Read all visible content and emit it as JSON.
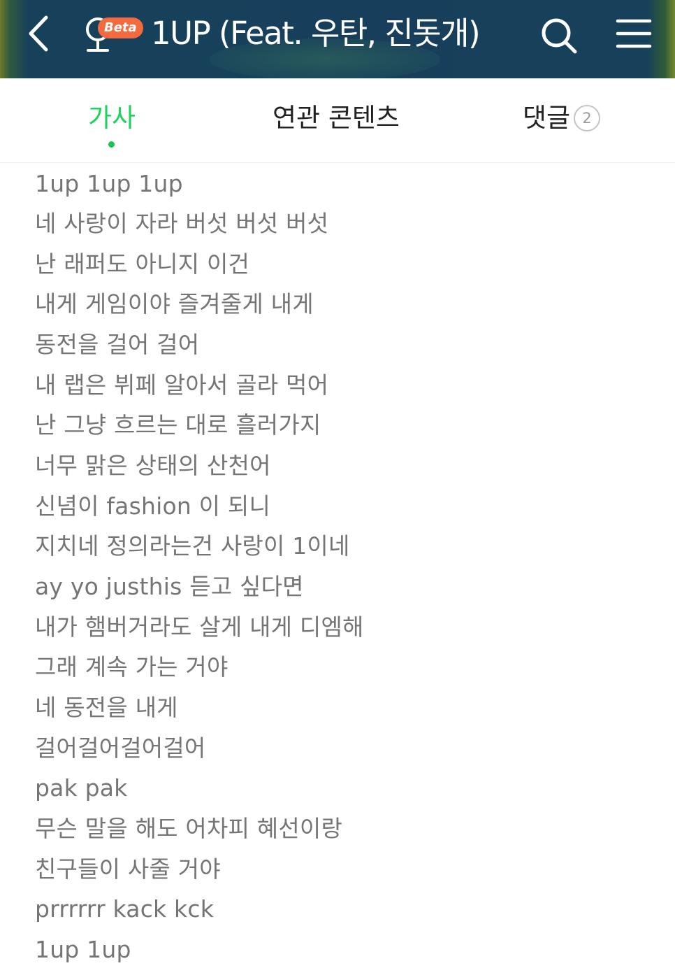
{
  "header": {
    "song_title": "1UP (Feat. 우탄, 진돗개)",
    "beta_badge": "Beta",
    "back_icon": "chevron-left-icon",
    "mic_icon": "microphone-icon",
    "search_icon": "search-icon",
    "menu_icon": "hamburger-menu-icon"
  },
  "tabs": [
    {
      "label": "가사",
      "active": true
    },
    {
      "label": "연관 콘텐츠",
      "active": false
    },
    {
      "label": "댓글",
      "count": "2",
      "active": false
    }
  ],
  "colors": {
    "accent_green": "#1fd25f",
    "header_bg": "#173f5c",
    "beta_badge": "#f26a3d",
    "lyric_text": "#757575"
  },
  "lyrics": [
    "1up 1up 1up",
    "네 사랑이 자라 버섯 버섯 버섯",
    "난 래퍼도 아니지 이건",
    "내게 게임이야 즐겨줄게 내게",
    "동전을 걸어 걸어",
    "내 랩은 뷔페 알아서 골라 먹어",
    "난 그냥 흐르는 대로 흘러가지",
    "너무 맑은 상태의 산천어",
    "신념이 fashion 이 되니",
    "지치네 정의라는건 사랑이 1이네",
    "ay yo justhis 듣고 싶다면",
    "내가 햄버거라도 살게 내게 디엠해",
    "그래 계속 가는 거야",
    "네 동전을 내게",
    "걸어걸어걸어걸어",
    "pak pak",
    "무슨 말을 해도 어차피 혜선이랑",
    "친구들이 사줄 거야",
    "prrrrrr kack kck",
    "1up 1up"
  ]
}
